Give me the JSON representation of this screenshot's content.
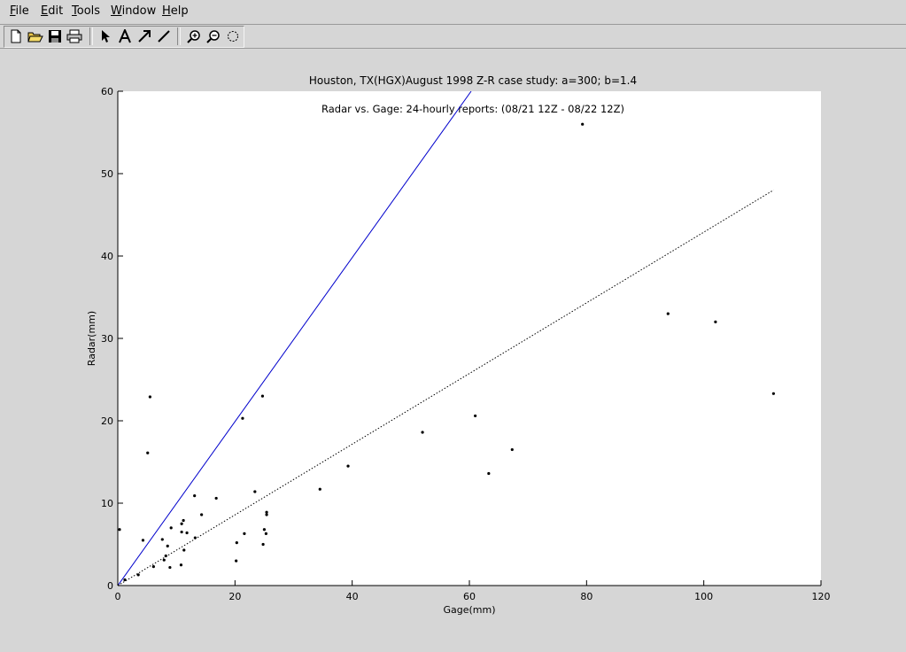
{
  "menu": {
    "items": [
      {
        "accel": "F",
        "rest": "ile"
      },
      {
        "accel": "E",
        "rest": "dit"
      },
      {
        "accel": "T",
        "rest": "ools"
      },
      {
        "accel": "W",
        "rest": "indow"
      },
      {
        "accel": "H",
        "rest": "elp"
      }
    ]
  },
  "toolbar": {
    "buttons": [
      "new-file-icon",
      "open-folder-icon",
      "save-icon",
      "print-icon",
      "pointer-icon",
      "text-tool-icon",
      "arrow-tool-icon",
      "line-tool-icon",
      "zoom-in-icon",
      "zoom-out-icon",
      "rotate-icon"
    ]
  },
  "chart_data": {
    "type": "scatter",
    "title": "Houston, TX(HGX)August 1998 Z-R case study: a=300; b=1.4",
    "subtitle": "Radar vs. Gage: 24-hourly reports: (08/21 12Z - 08/22 12Z)",
    "xlabel": "Gage(mm)",
    "ylabel": "Radar(mm)",
    "xlim": [
      0,
      120
    ],
    "ylim": [
      0,
      60
    ],
    "xticks": [
      0,
      20,
      40,
      60,
      80,
      100,
      120
    ],
    "yticks": [
      0,
      10,
      20,
      30,
      40,
      50,
      60
    ],
    "grid": false,
    "colors": {
      "points": "#000000",
      "one_to_one_line": "#0000cc",
      "fit_line": "#000000"
    },
    "series": [
      {
        "type": "scatter",
        "x": [
          0.3,
          1.2,
          3.5,
          4.3,
          5.1,
          5.5,
          6.1,
          7.6,
          7.9,
          8.2,
          8.5,
          8.9,
          9.1,
          10.8,
          10.9,
          10.9,
          11.2,
          11.3,
          11.8,
          13.1,
          13.2,
          14.3,
          16.8,
          20.2,
          20.3,
          21.3,
          21.6,
          23.4,
          24.7,
          24.8,
          25.0,
          25.3,
          25.4,
          25.4,
          34.5,
          39.3,
          52.0,
          61.0,
          63.3,
          67.3,
          79.3,
          93.9,
          102.0,
          111.9
        ],
        "y": [
          6.8,
          0.7,
          1.3,
          5.5,
          16.1,
          22.9,
          2.3,
          5.6,
          3.1,
          3.6,
          4.8,
          2.2,
          7.0,
          2.5,
          6.5,
          7.5,
          7.9,
          4.3,
          6.4,
          10.9,
          5.8,
          8.6,
          10.6,
          3.0,
          5.2,
          20.3,
          6.3,
          11.4,
          23.0,
          5.0,
          6.8,
          6.3,
          8.6,
          8.9,
          11.7,
          14.5,
          18.6,
          20.6,
          13.6,
          16.5,
          56.0,
          33.0,
          32.0,
          23.3
        ]
      },
      {
        "type": "line",
        "style": "solid",
        "x": [
          0,
          60.3
        ],
        "y": [
          0,
          60
        ]
      },
      {
        "type": "line",
        "style": "dotted",
        "x": [
          0,
          111.9
        ],
        "y": [
          0,
          48
        ]
      }
    ]
  }
}
